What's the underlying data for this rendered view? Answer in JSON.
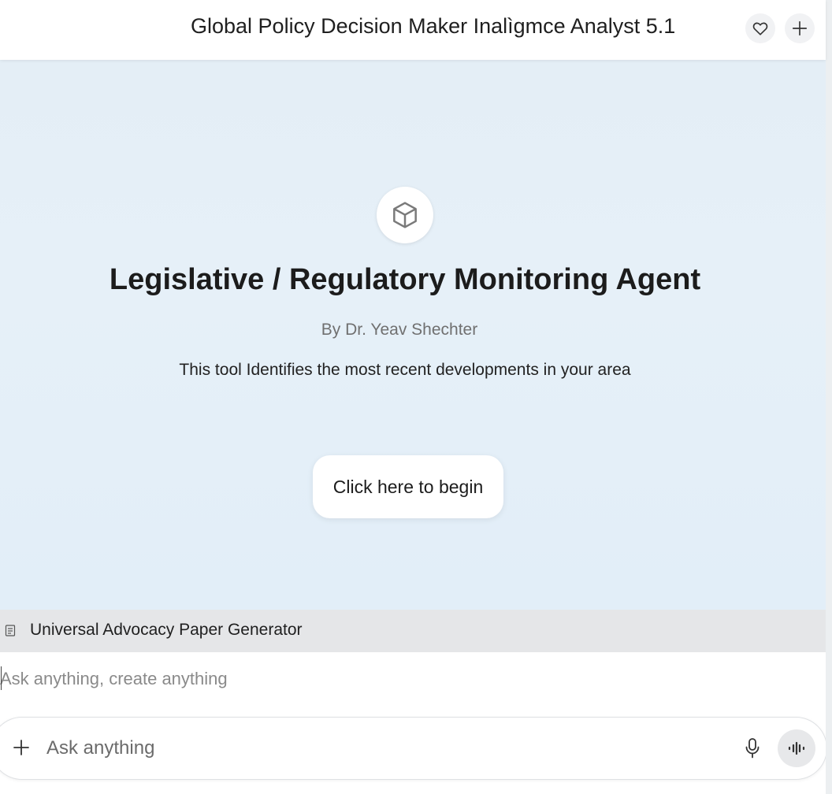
{
  "header": {
    "title": "Global Policy Decision Maker Inalìgmce Analyst 5.1",
    "favorite_icon": "heart-icon",
    "new_icon": "plus-icon"
  },
  "agent": {
    "icon": "cube-icon",
    "title": "Legislative / Regulatory Monitoring Agent",
    "author": "By Dr. Yeav Shechter",
    "description": "This tool Identifies the most recent developments in your area",
    "begin_label": "Click here to begin"
  },
  "attachment": {
    "icon": "document-icon",
    "label": "Universal Advocacy Paper Generator"
  },
  "prompt": {
    "placeholder": "Ask anything, create anything",
    "value": ""
  },
  "composer": {
    "placeholder": "Ask anything",
    "add_icon": "plus-icon",
    "mic_icon": "microphone-icon",
    "voice_icon": "voice-waveform-icon"
  },
  "colors": {
    "hero_background": "#e4eef6",
    "attachment_bar": "#e5e6e8",
    "button_background": "#ffffff"
  }
}
